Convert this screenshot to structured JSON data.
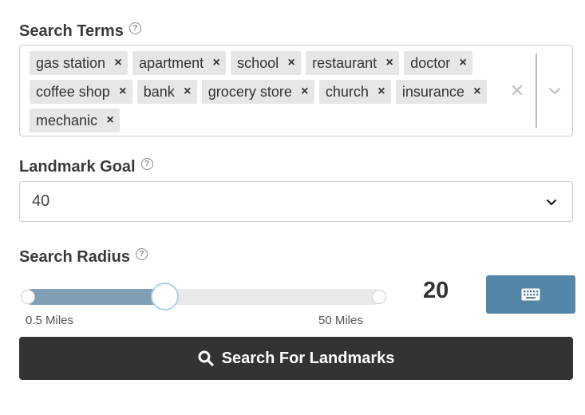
{
  "search_terms": {
    "label": "Search Terms",
    "help_icon": "?",
    "tags": [
      {
        "label": "gas station",
        "remove": "×"
      },
      {
        "label": "apartment",
        "remove": "×"
      },
      {
        "label": "school",
        "remove": "×"
      },
      {
        "label": "restaurant",
        "remove": "×"
      },
      {
        "label": "doctor",
        "remove": "×"
      },
      {
        "label": "coffee shop",
        "remove": "×"
      },
      {
        "label": "bank",
        "remove": "×"
      },
      {
        "label": "grocery store",
        "remove": "×"
      },
      {
        "label": "church",
        "remove": "×"
      },
      {
        "label": "insurance",
        "remove": "×"
      },
      {
        "label": "mechanic",
        "remove": "×"
      }
    ],
    "clear_icon": "close-icon",
    "dropdown_icon": "chevron-down-icon"
  },
  "landmark_goal": {
    "label": "Landmark Goal",
    "help_icon": "?",
    "value": "40",
    "dropdown_icon": "chevron-down-icon"
  },
  "search_radius": {
    "label": "Search Radius",
    "help_icon": "?",
    "min_label": "0.5 Miles",
    "max_label": "50 Miles",
    "value": "20",
    "slider_min": 0.5,
    "slider_max": 50,
    "slider_value": 20,
    "keyboard_icon": "keyboard-icon",
    "accent_color": "#5487a7"
  },
  "search_button": {
    "label": "Search For Landmarks",
    "icon": "search-icon",
    "color": "#333333"
  }
}
